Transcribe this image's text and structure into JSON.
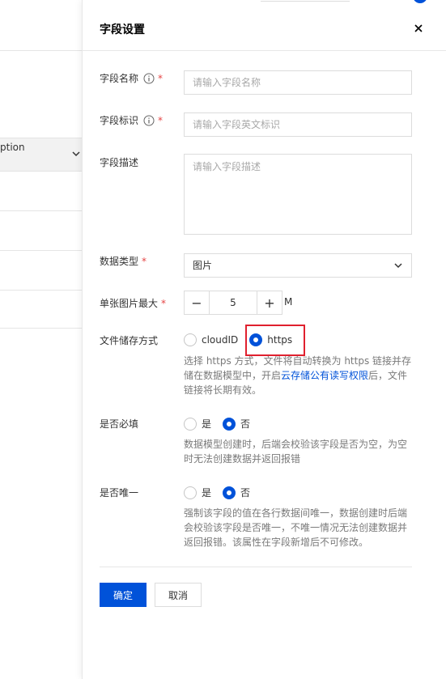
{
  "background": {
    "table_header_text": "ption"
  },
  "drawer": {
    "title": "字段设置",
    "close_icon": "close-icon",
    "fields": {
      "name": {
        "label": "字段名称",
        "required_mark": "*",
        "placeholder": "请输入字段名称"
      },
      "identifier": {
        "label": "字段标识",
        "required_mark": "*",
        "placeholder": "请输入字段英文标识"
      },
      "description": {
        "label": "字段描述",
        "placeholder": "请输入字段描述"
      },
      "data_type": {
        "label": "数据类型",
        "required_mark": "*",
        "value": "图片"
      },
      "max_size": {
        "label": "单张图片最大",
        "required_mark": "*",
        "value": "5",
        "unit": "M",
        "minus": "−",
        "plus": "+"
      },
      "storage": {
        "label": "文件储存方式",
        "options": [
          "cloudID",
          "https"
        ],
        "selected": "https",
        "help_before": "选择 https 方式，文件将自动转换为 https 链接并存储在数据模型中，开启",
        "help_link": "云存储公有读写权限",
        "help_after": "后，文件链接将长期有效。"
      },
      "required": {
        "label": "是否必填",
        "options": [
          "是",
          "否"
        ],
        "selected": "否",
        "help": "数据模型创建时，后端会校验该字段是否为空，为空时无法创建数据并返回报错"
      },
      "unique": {
        "label": "是否唯一",
        "options": [
          "是",
          "否"
        ],
        "selected": "否",
        "help": "强制该字段的值在各行数据间唯一，数据创建时后端会校验该字段是否唯一，不唯一情况无法创建数据并返回报错。该属性在字段新增后不可修改。"
      }
    },
    "buttons": {
      "confirm": "确定",
      "cancel": "取消"
    },
    "colors": {
      "primary": "#0052d9",
      "required": "#e54545",
      "highlight": "#e0202e"
    }
  }
}
